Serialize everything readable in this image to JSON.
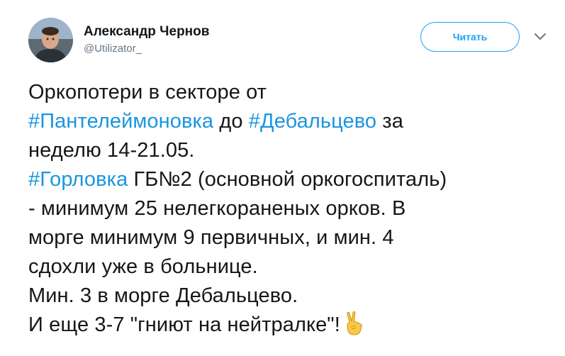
{
  "author": {
    "display_name": "Александр Чернов",
    "handle": "@Utilizator_"
  },
  "follow_button": {
    "label": "Читать"
  },
  "icons": {
    "more": "chevron-down-icon",
    "emoji": "victory-hand-icon",
    "avatar": "avatar"
  },
  "colors": {
    "link": "#1b95e0",
    "accent": "#1da1f2",
    "text": "#14171a",
    "muted": "#657786"
  },
  "tweet": {
    "lines": [
      {
        "parts": [
          {
            "text": "Оркопотери в секторе от"
          }
        ]
      },
      {
        "parts": [
          {
            "text": "#Пантелеймоновка",
            "hashtag": true
          },
          {
            "text": " до "
          },
          {
            "text": "#Дебальцево",
            "hashtag": true
          },
          {
            "text": " за"
          }
        ]
      },
      {
        "parts": [
          {
            "text": "неделю 14-21.05."
          }
        ]
      },
      {
        "parts": [
          {
            "text": "#Горловка",
            "hashtag": true
          },
          {
            "text": " ГБ№2 (основной оркогоспиталь)"
          }
        ]
      },
      {
        "parts": [
          {
            "text": "- минимум 25 нелегкораненых орков. В"
          }
        ]
      },
      {
        "parts": [
          {
            "text": "морге минимум 9 первичных, и мин. 4"
          }
        ]
      },
      {
        "parts": [
          {
            "text": "сдохли уже в больнице."
          }
        ]
      },
      {
        "parts": [
          {
            "text": "Мин. 3 в морге Дебальцево."
          }
        ]
      },
      {
        "parts": [
          {
            "text": "И еще 3-7 \"гниют на нейтралке\"!"
          }
        ],
        "emoji": true
      }
    ]
  }
}
